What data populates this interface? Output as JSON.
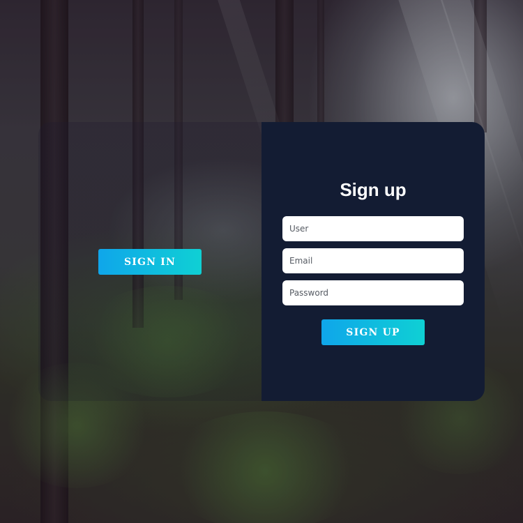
{
  "signin": {
    "button_label": "SIGN IN"
  },
  "signup": {
    "title": "Sign up",
    "fields": {
      "user_placeholder": "User",
      "email_placeholder": "Email",
      "password_placeholder": "Password"
    },
    "button_label": "SIGN UP"
  },
  "colors": {
    "panel": "#131c33",
    "button_gradient_start": "#0fa6ea",
    "button_gradient_end": "#0fd0d4",
    "button_text": "#ffffff"
  }
}
